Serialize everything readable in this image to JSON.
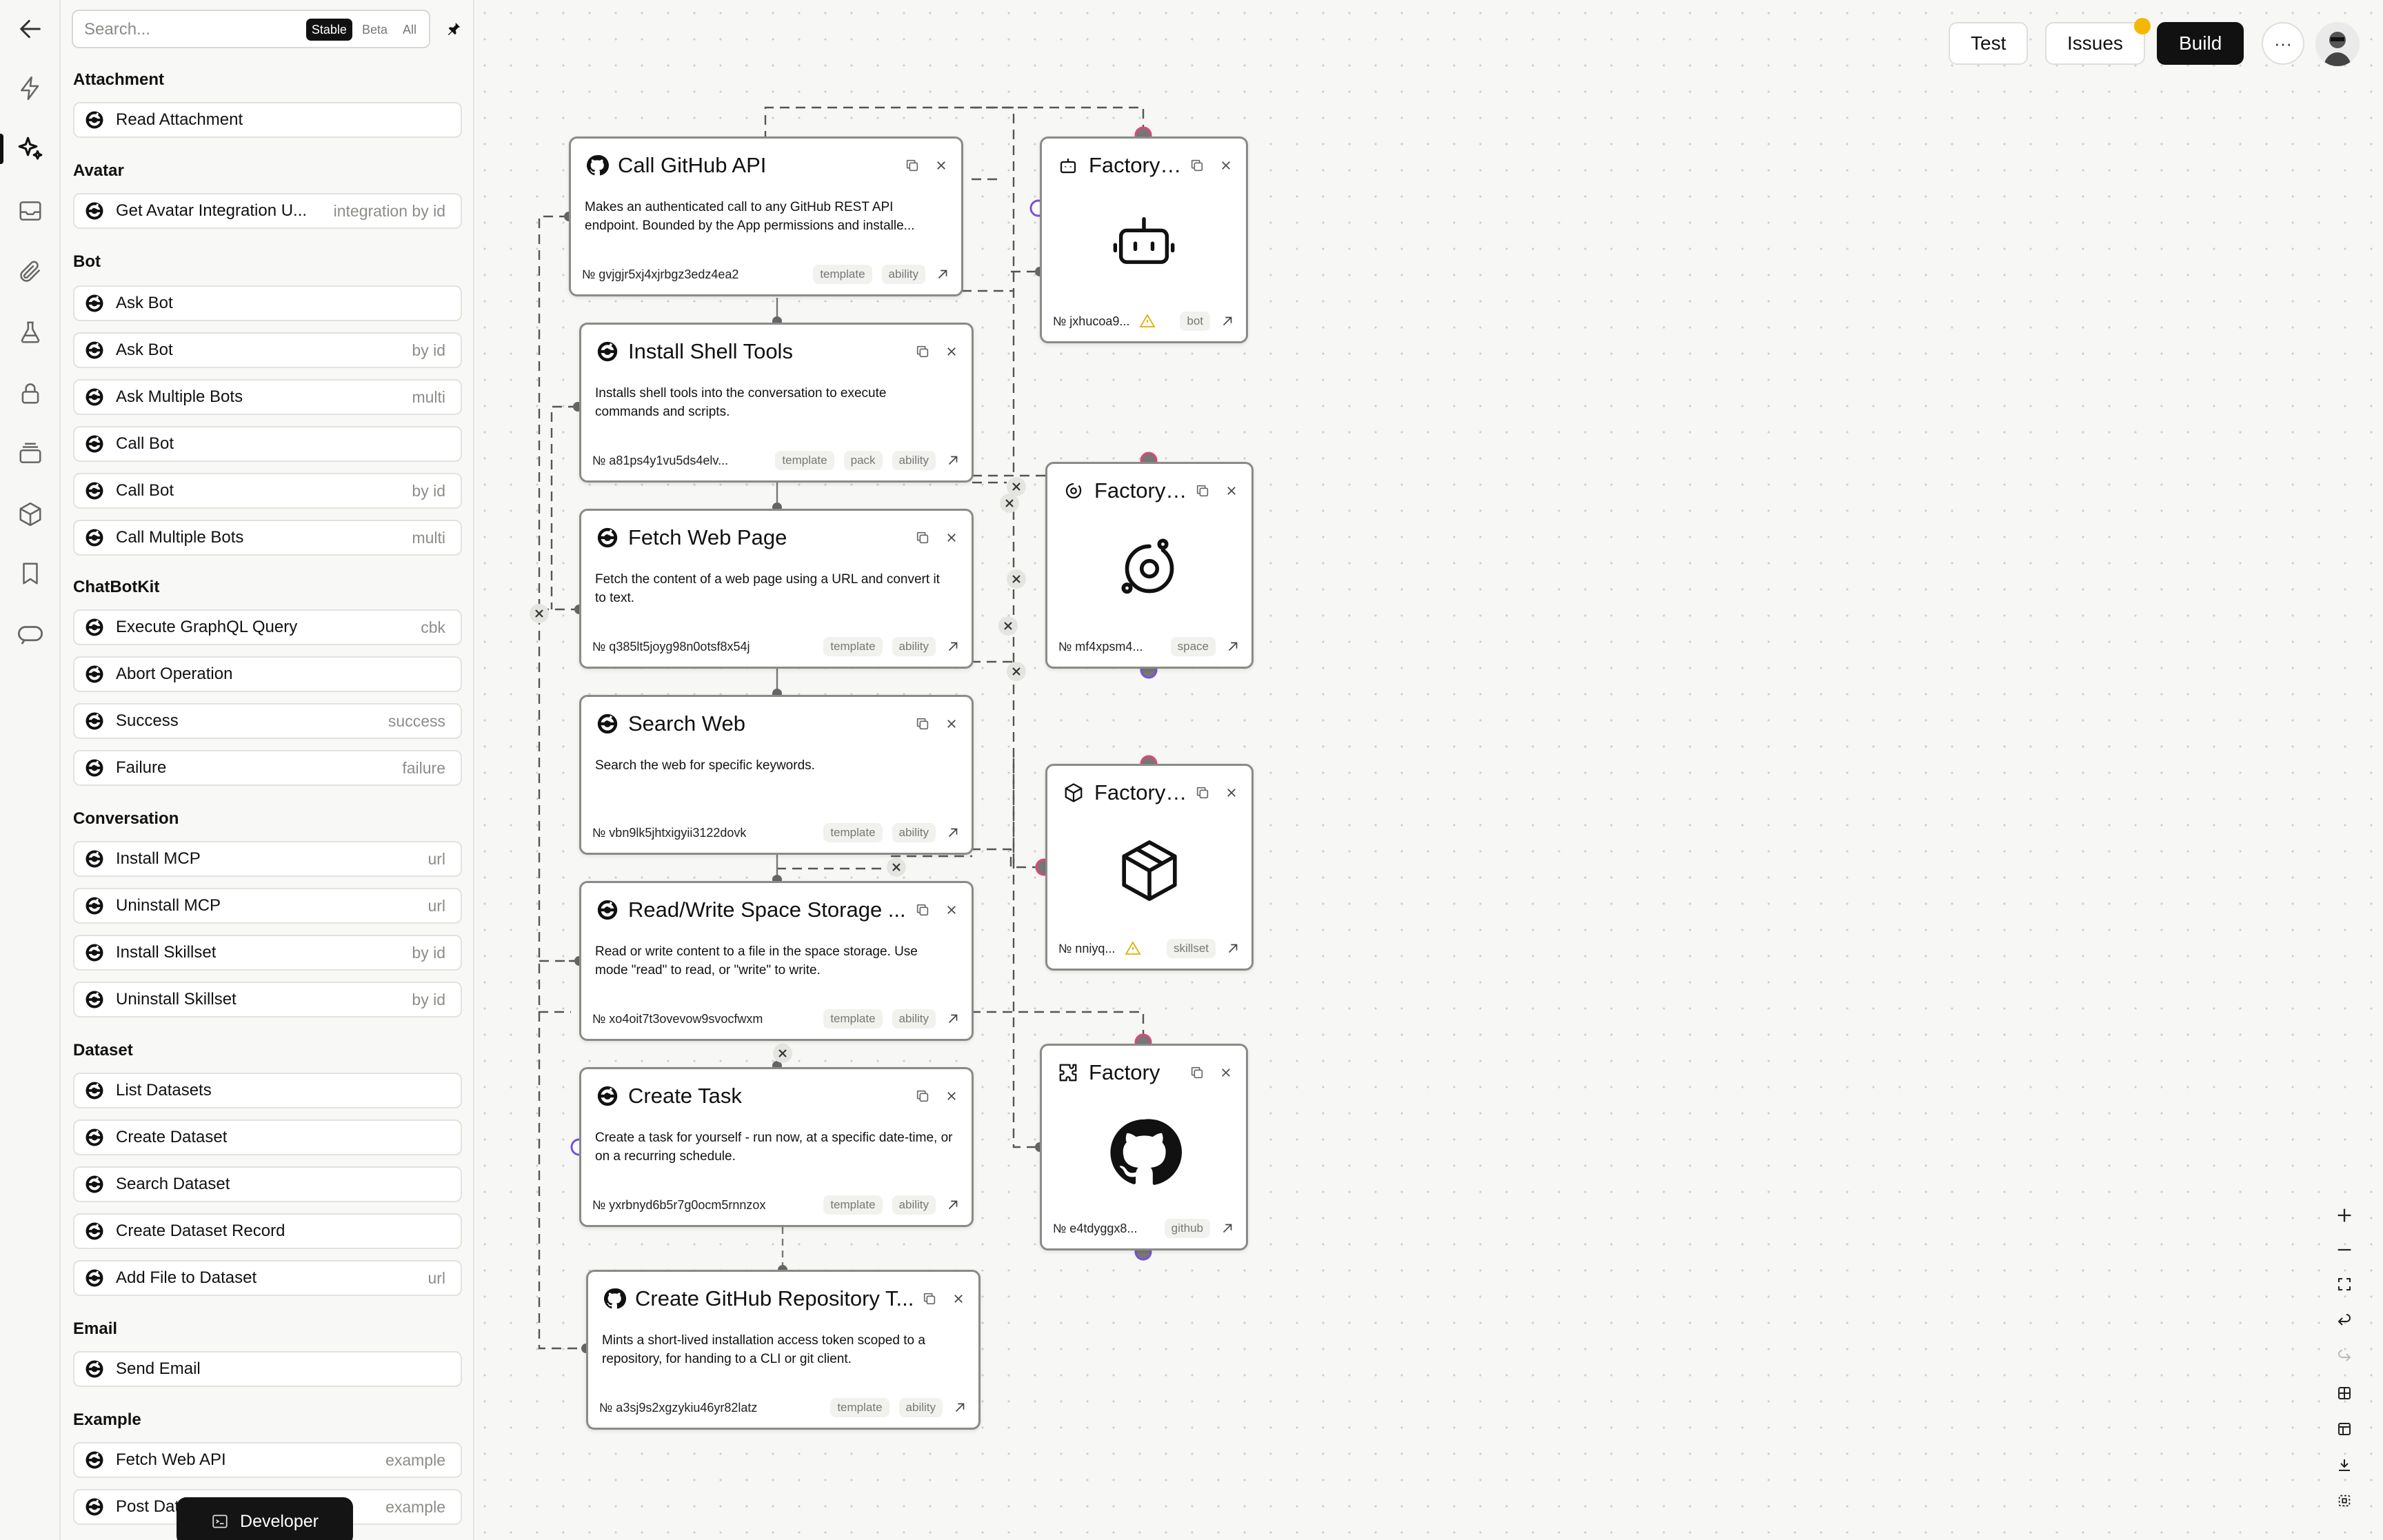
{
  "search": {
    "placeholder": "Search..."
  },
  "filters": [
    "Stable",
    "Beta",
    "All"
  ],
  "sidebar_categories": [
    {
      "name": "Attachment",
      "items": [
        {
          "label": "Read Attachment",
          "tag": ""
        }
      ]
    },
    {
      "name": "Avatar",
      "items": [
        {
          "label": "Get Avatar Integration U...",
          "tag": "integration by id"
        }
      ]
    },
    {
      "name": "Bot",
      "items": [
        {
          "label": "Ask Bot",
          "tag": ""
        },
        {
          "label": "Ask Bot",
          "tag": "by id"
        },
        {
          "label": "Ask Multiple Bots",
          "tag": "multi"
        },
        {
          "label": "Call Bot",
          "tag": ""
        },
        {
          "label": "Call Bot",
          "tag": "by id"
        },
        {
          "label": "Call Multiple Bots",
          "tag": "multi"
        }
      ]
    },
    {
      "name": "ChatBotKit",
      "items": [
        {
          "label": "Execute GraphQL Query",
          "tag": "cbk"
        },
        {
          "label": "Abort Operation",
          "tag": ""
        },
        {
          "label": "Success",
          "tag": "success"
        },
        {
          "label": "Failure",
          "tag": "failure"
        }
      ]
    },
    {
      "name": "Conversation",
      "items": [
        {
          "label": "Install MCP",
          "tag": "url"
        },
        {
          "label": "Uninstall MCP",
          "tag": "url"
        },
        {
          "label": "Install Skillset",
          "tag": "by id"
        },
        {
          "label": "Uninstall Skillset",
          "tag": "by id"
        }
      ]
    },
    {
      "name": "Dataset",
      "items": [
        {
          "label": "List Datasets",
          "tag": ""
        },
        {
          "label": "Create Dataset",
          "tag": ""
        },
        {
          "label": "Search Dataset",
          "tag": ""
        },
        {
          "label": "Create Dataset Record",
          "tag": ""
        },
        {
          "label": "Add File to Dataset",
          "tag": "url"
        }
      ]
    },
    {
      "name": "Email",
      "items": [
        {
          "label": "Send Email",
          "tag": ""
        }
      ]
    },
    {
      "name": "Example",
      "items": [
        {
          "label": "Fetch Web API",
          "tag": "example"
        },
        {
          "label": "Post Dat",
          "tag": "example"
        }
      ]
    }
  ],
  "developer_button": "Developer",
  "toolbar": {
    "test": "Test",
    "issues": "Issues",
    "build": "Build",
    "more": "···"
  },
  "ability_nodes": [
    {
      "title": "Call GitHub API",
      "icon": "github-icon",
      "description": "Makes an authenticated call to any GitHub REST API endpoint. Bounded by the App permissions and installe...",
      "id": "№ gvjgjr5xj4xjrbgz3edz4ea2",
      "pills": [
        "template",
        "ability"
      ]
    },
    {
      "title": "Install Shell Tools",
      "icon": "chatbotkit-icon",
      "description": "Installs shell tools into the conversation to execute commands and scripts.",
      "id": "№ a81ps4y1vu5ds4elv...",
      "pills": [
        "template",
        "pack",
        "ability"
      ]
    },
    {
      "title": "Fetch Web Page",
      "icon": "chatbotkit-icon",
      "description": "Fetch the content of a web page using a URL and convert it to text.",
      "id": "№ q385lt5joyg98n0otsf8x54j",
      "pills": [
        "template",
        "ability"
      ]
    },
    {
      "title": "Search Web",
      "icon": "chatbotkit-icon",
      "description": "Search the web for specific keywords.",
      "id": "№ vbn9lk5jhtxigyii3122dovk",
      "pills": [
        "template",
        "ability"
      ]
    },
    {
      "title": "Read/Write Space Storage ...",
      "icon": "chatbotkit-icon",
      "description": "Read or write content to a file in the space storage. Use mode \"read\" to read, or \"write\" to write.",
      "id": "№ xo4oit7t3ovevow9svocfwxm",
      "pills": [
        "template",
        "ability"
      ]
    },
    {
      "title": "Create Task",
      "icon": "chatbotkit-icon",
      "description": "Create a task for yourself - run now, at a specific date-time, or on a recurring schedule.",
      "id": "№ yxrbnyd6b5r7g0ocm5rnnzox",
      "pills": [
        "template",
        "ability"
      ]
    },
    {
      "title": "Create GitHub Repository T...",
      "icon": "github-icon",
      "description": "Mints a short-lived installation access token scoped to a repository, for handing to a CLI or git client.",
      "id": "№ a3sj9s2xgzykiu46yr82latz",
      "pills": [
        "template",
        "ability"
      ]
    }
  ],
  "factory_nodes": [
    {
      "title": "Factory ...",
      "icon": "bot-icon",
      "id": "№ jxhucoa9...",
      "warning": true,
      "pill": "bot"
    },
    {
      "title": "Factory ...",
      "icon": "space-icon",
      "id": "№ mf4xpsm4...",
      "warning": false,
      "pill": "space"
    },
    {
      "title": "Factory ...",
      "icon": "box-icon",
      "id": "№ nniyq...",
      "warning": true,
      "pill": "skillset"
    },
    {
      "title": "Factory",
      "icon": "github-icon",
      "id": "№ e4tdyggx8...",
      "warning": false,
      "pill": "github"
    }
  ],
  "zoom_controls": [
    "zoom-in",
    "zoom-out",
    "fit-view",
    "undo",
    "redo",
    "grid",
    "columns",
    "download",
    "minimap"
  ]
}
